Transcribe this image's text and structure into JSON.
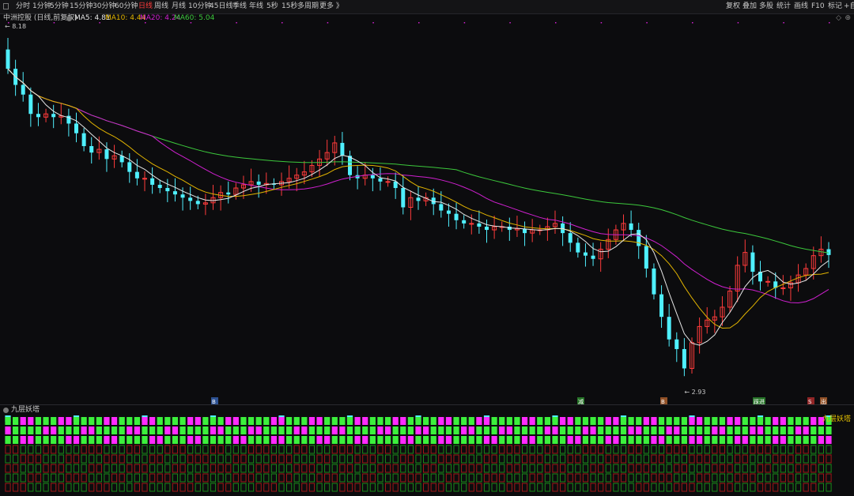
{
  "toolbar": {
    "periods": [
      "分时",
      "1分钟",
      "5分钟",
      "15分钟",
      "30分钟",
      "60分钟",
      "日线",
      "周线",
      "月线",
      "10分钟",
      "45日线",
      "季线",
      "年线",
      "5秒",
      "15秒",
      "多周期",
      "更多 》"
    ],
    "active_period": "日线",
    "right_items": [
      "复权",
      "叠加",
      "多股",
      "统计",
      "画线",
      "F10",
      "标记",
      "+自"
    ]
  },
  "info": {
    "stock": "中洲控股 (日线,前复权)",
    "ma5": "MA5: 4.81",
    "ma10": "MA10: 4.44",
    "ma20": "MA20: 4.24",
    "ma60": "MA60: 5.04"
  },
  "colors": {
    "up": "#ff3b3b",
    "down": "#4ff0ff",
    "ma5": "#e8e8e8",
    "ma10": "#e2b400",
    "ma20": "#d020d0",
    "ma60": "#3cc83c",
    "active": "#ff3b3b"
  },
  "chart_data": {
    "type": "candlestick",
    "price_high_label": "8.18",
    "price_low_label": "2.93",
    "closes": [
      7.7,
      7.45,
      7.3,
      7.0,
      6.95,
      7.0,
      6.95,
      6.97,
      6.85,
      6.7,
      6.5,
      6.4,
      6.45,
      6.3,
      6.35,
      6.25,
      6.1,
      6.0,
      6.0,
      5.9,
      5.85,
      5.8,
      5.75,
      5.7,
      5.65,
      5.6,
      5.62,
      5.7,
      5.78,
      5.75,
      5.85,
      5.9,
      5.95,
      5.9,
      5.92,
      5.9,
      5.95,
      6.0,
      6.05,
      6.1,
      6.2,
      6.3,
      6.4,
      6.55,
      6.35,
      6.05,
      6.0,
      6.05,
      6.0,
      5.95,
      5.95,
      5.85,
      5.55,
      5.7,
      5.65,
      5.7,
      5.6,
      5.5,
      5.45,
      5.35,
      5.3,
      5.3,
      5.25,
      5.2,
      5.25,
      5.25,
      5.2,
      5.22,
      5.15,
      5.2,
      5.2,
      5.25,
      5.3,
      5.15,
      5.0,
      4.85,
      4.8,
      4.75,
      4.9,
      5.05,
      5.2,
      5.3,
      5.2,
      4.95,
      4.6,
      4.2,
      3.85,
      3.5,
      3.35,
      3.05,
      3.45,
      3.7,
      3.8,
      3.85,
      4.0,
      4.25,
      4.65,
      4.85,
      4.55,
      4.4,
      4.4,
      4.3,
      4.3,
      4.38,
      4.5,
      4.6,
      4.8,
      4.9,
      4.81
    ],
    "signal_labels": [
      "B",
      "减",
      "B",
      "踩进",
      "S",
      "出"
    ],
    "indicator_name": "九层妖塔"
  }
}
